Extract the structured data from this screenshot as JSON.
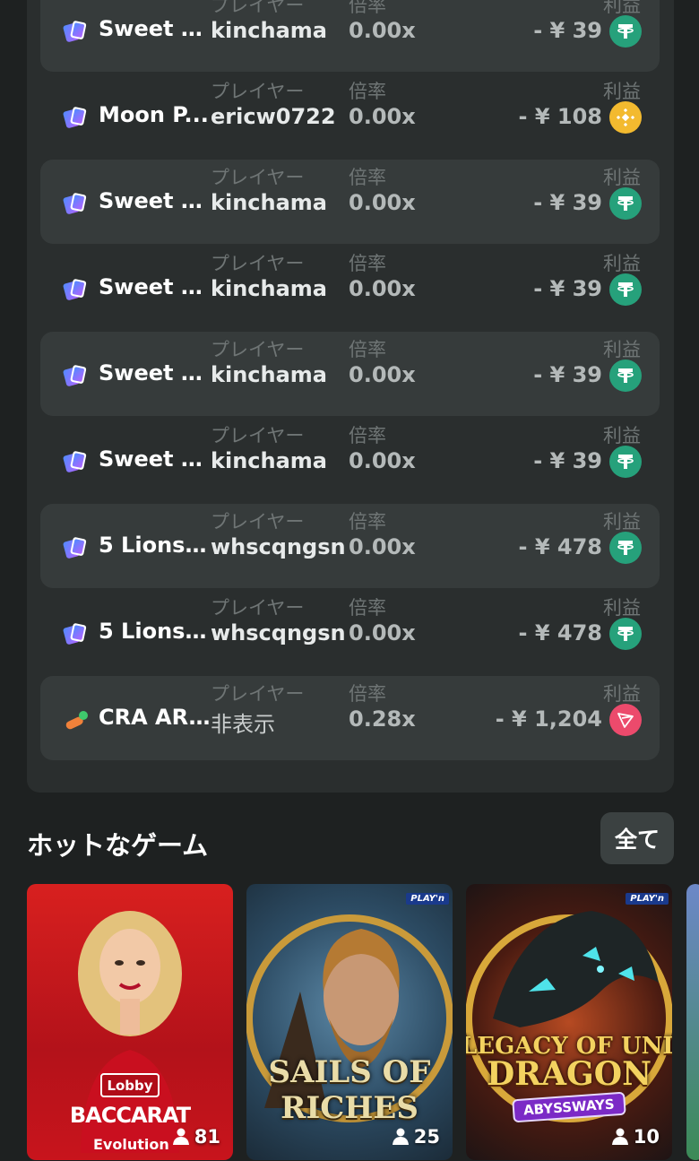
{
  "bets": {
    "labels": {
      "player": "プレイヤー",
      "multiplier": "倍率",
      "profit": "利益"
    },
    "rows": [
      {
        "game": "Sweet B...",
        "game_icon": "card-game-icon",
        "player": "kinchama",
        "multiplier": "0.00x",
        "profit": "- ¥ 39",
        "currency_icon": "usdt-icon"
      },
      {
        "game": "Moon P...",
        "game_icon": "card-game-icon",
        "player": "ericw0722",
        "multiplier": "0.00x",
        "profit": "- ¥ 108",
        "currency_icon": "bnb-icon"
      },
      {
        "game": "Sweet B...",
        "game_icon": "card-game-icon",
        "player": "kinchama",
        "multiplier": "0.00x",
        "profit": "- ¥ 39",
        "currency_icon": "usdt-icon"
      },
      {
        "game": "Sweet B...",
        "game_icon": "card-game-icon",
        "player": "kinchama",
        "multiplier": "0.00x",
        "profit": "- ¥ 39",
        "currency_icon": "usdt-icon"
      },
      {
        "game": "Sweet B...",
        "game_icon": "card-game-icon",
        "player": "kinchama",
        "multiplier": "0.00x",
        "profit": "- ¥ 39",
        "currency_icon": "usdt-icon"
      },
      {
        "game": "Sweet B...",
        "game_icon": "card-game-icon",
        "player": "kinchama",
        "multiplier": "0.00x",
        "profit": "- ¥ 39",
        "currency_icon": "usdt-icon"
      },
      {
        "game": "5 Lions ...",
        "game_icon": "card-game-icon",
        "player": "whscqngsn",
        "multiplier": "0.00x",
        "profit": "- ¥ 478",
        "currency_icon": "usdt-icon"
      },
      {
        "game": "5 Lions ...",
        "game_icon": "card-game-icon",
        "player": "whscqngsn",
        "multiplier": "0.00x",
        "profit": "- ¥ 478",
        "currency_icon": "usdt-icon"
      },
      {
        "game": "CRA AR...",
        "game_icon": "crash-game-icon",
        "player": "非表示",
        "multiplier": "0.28x",
        "profit": "- ¥ 1,204",
        "currency_icon": "trx-icon"
      }
    ]
  },
  "hot_games": {
    "title": "ホットなゲーム",
    "all_button": "全て",
    "cards": [
      {
        "name": "BACCARAT",
        "badge": "Lobby",
        "provider": "Evolution",
        "players": "81"
      },
      {
        "name": "SAILS OF RICHES",
        "tag": "PLAY'n",
        "players": "25"
      },
      {
        "name_line1": "LEGACY OF UNDEAD",
        "name_line2": "DRAGON",
        "badge": "ABYSSWAYS",
        "tag": "PLAY'n",
        "players": "10"
      }
    ]
  }
}
